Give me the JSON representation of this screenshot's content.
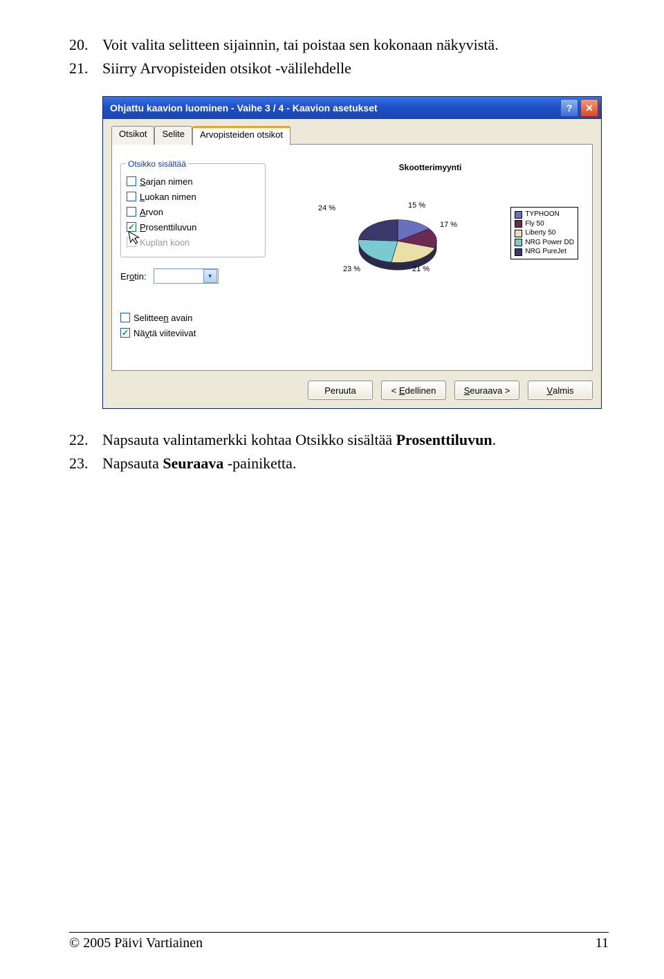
{
  "instructions": {
    "i20_num": "20.",
    "i20_text": "Voit valita selitteen sijainnin, tai poistaa sen kokonaan näkyvistä.",
    "i21_num": "21.",
    "i21_text": "Siirry Arvopisteiden otsikot -välilehdelle",
    "i22_num": "22.",
    "i22_text_a": "Napsauta valintamerkki kohtaa Otsikko sisältää ",
    "i22_text_b": "Prosenttiluvun",
    "i22_text_c": ".",
    "i23_num": "23.",
    "i23_text_a": "Napsauta ",
    "i23_text_b": "Seuraava",
    "i23_text_c": " -painiketta."
  },
  "dialog": {
    "title": "Ohjattu kaavion luominen - Vaihe 3 / 4 - Kaavion asetukset",
    "help_glyph": "?",
    "close_glyph": "✕",
    "tabs": {
      "t1": "Otsikot",
      "t2": "Selite",
      "t3": "Arvopisteiden otsikot"
    },
    "group_label": "Otsikko sisältää",
    "checks": {
      "c1": "Sarjan nimen",
      "c2": "Luokan nimen",
      "c3": "Arvon",
      "c4": "Prosenttiluvun",
      "c5": "Kuplan koon"
    },
    "erotin_label": "Erotin:",
    "lower": {
      "l1": "Selitteen avain",
      "l2": "Näytä viiteviivat"
    },
    "buttons": {
      "cancel": "Peruuta",
      "back_lt": "<",
      "back_u": "E",
      "back_rest": "dellinen",
      "next_u": "S",
      "next_rest": "euraava",
      "next_gt": ">",
      "finish_u": "V",
      "finish_rest": "almis"
    }
  },
  "chart_data": {
    "type": "pie",
    "title": "Skootterimyynti",
    "categories": [
      "TYPHOON",
      "Fly 50",
      "Liberty 50",
      "NRG Power DD",
      "NRG PureJet"
    ],
    "values": [
      15,
      17,
      21,
      23,
      24
    ],
    "labels_pct": [
      "15 %",
      "17 %",
      "21 %",
      "23 %",
      "24 %"
    ],
    "colors": [
      "#6a6fc0",
      "#6a2a52",
      "#e8e0a8",
      "#7acad2",
      "#3a3a6a"
    ],
    "legend_position": "right"
  },
  "footer": {
    "copyright": "© 2005 Päivi Vartiainen",
    "page": "11"
  }
}
